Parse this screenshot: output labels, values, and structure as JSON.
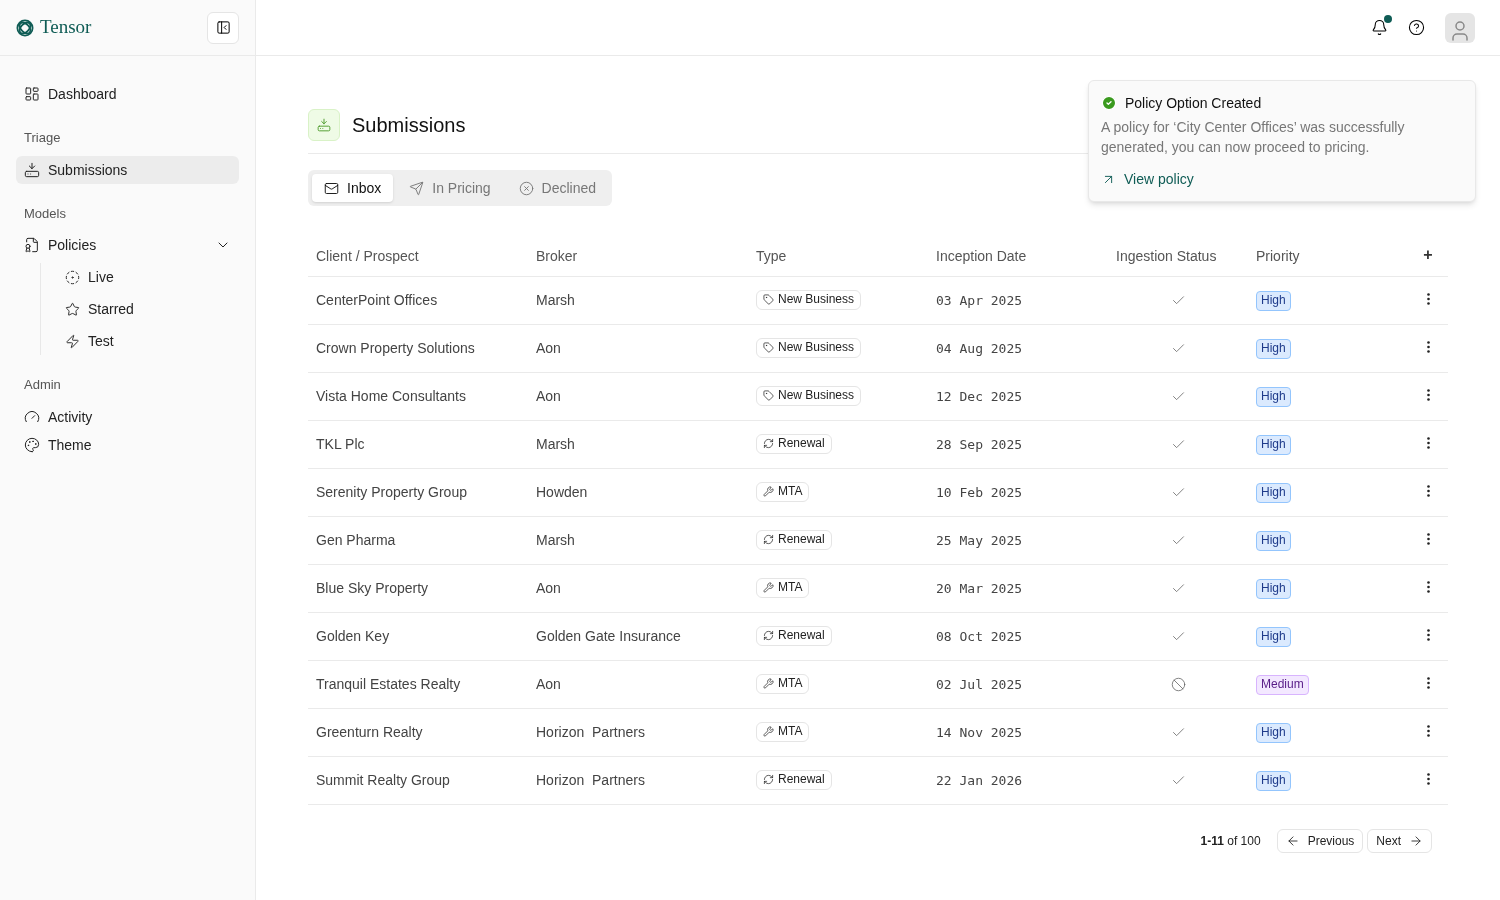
{
  "brand": {
    "name": "Tensor"
  },
  "sidebar": {
    "items": [
      {
        "kind": "item",
        "label": "Dashboard",
        "selected": false
      },
      {
        "kind": "heading",
        "label": "Triage"
      },
      {
        "kind": "item",
        "label": "Submissions",
        "selected": true
      },
      {
        "kind": "heading",
        "label": "Models"
      },
      {
        "kind": "item",
        "label": "Policies",
        "selected": false,
        "expanded": true,
        "children": [
          {
            "label": "Live",
            "selected": false
          },
          {
            "label": "Starred",
            "selected": false
          },
          {
            "label": "Test",
            "selected": false
          }
        ]
      },
      {
        "kind": "heading",
        "label": "Admin"
      },
      {
        "kind": "item",
        "label": "Activity",
        "selected": false
      },
      {
        "kind": "item",
        "label": "Theme",
        "selected": false
      }
    ]
  },
  "header": {
    "notifications_unread": true
  },
  "page": {
    "title": "Submissions"
  },
  "tabs": [
    {
      "label": "Inbox",
      "selected": true
    },
    {
      "label": "In Pricing",
      "selected": false
    },
    {
      "label": "Declined",
      "selected": false
    }
  ],
  "table": {
    "columns": [
      "Client / Prospect",
      "Broker",
      "Type",
      "Inception Date",
      "Ingestion Status",
      "Priority"
    ],
    "add_column": "+",
    "rows": [
      {
        "client": "CenterPoint Offices",
        "broker": "Marsh",
        "type": {
          "kind": "new_business",
          "label": "New Business"
        },
        "date": "03 Apr 2025",
        "ingested": true,
        "priority": {
          "kind": "high",
          "label": "High"
        }
      },
      {
        "client": "Crown Property Solutions",
        "broker": "Aon",
        "type": {
          "kind": "new_business",
          "label": "New Business"
        },
        "date": "04 Aug 2025",
        "ingested": true,
        "priority": {
          "kind": "high",
          "label": "High"
        }
      },
      {
        "client": "Vista Home Consultants",
        "broker": "Aon",
        "type": {
          "kind": "new_business",
          "label": "New Business"
        },
        "date": "12 Dec 2025",
        "ingested": true,
        "priority": {
          "kind": "high",
          "label": "High"
        }
      },
      {
        "client": "TKL Plc",
        "broker": "Marsh",
        "type": {
          "kind": "renewal",
          "label": "Renewal"
        },
        "date": "28 Sep 2025",
        "ingested": true,
        "priority": {
          "kind": "high",
          "label": "High"
        }
      },
      {
        "client": "Serenity Property Group",
        "broker": "Howden",
        "type": {
          "kind": "mta",
          "label": "MTA"
        },
        "date": "10 Feb 2025",
        "ingested": true,
        "priority": {
          "kind": "high",
          "label": "High"
        }
      },
      {
        "client": "Gen Pharma",
        "broker": "Marsh",
        "type": {
          "kind": "renewal",
          "label": "Renewal"
        },
        "date": "25 May 2025",
        "ingested": true,
        "priority": {
          "kind": "high",
          "label": "High"
        }
      },
      {
        "client": "Blue Sky Property",
        "broker": "Aon",
        "type": {
          "kind": "mta",
          "label": "MTA"
        },
        "date": "20 Mar 2025",
        "ingested": true,
        "priority": {
          "kind": "high",
          "label": "High"
        }
      },
      {
        "client": "Golden Key",
        "broker": "Golden Gate Insurance",
        "type": {
          "kind": "renewal",
          "label": "Renewal"
        },
        "date": "08 Oct 2025",
        "ingested": true,
        "priority": {
          "kind": "high",
          "label": "High"
        }
      },
      {
        "client": "Tranquil Estates Realty",
        "broker": "Aon",
        "type": {
          "kind": "mta",
          "label": "MTA"
        },
        "date": "02 Jul 2025",
        "ingested": false,
        "priority": {
          "kind": "medium",
          "label": "Medium"
        }
      },
      {
        "client": "Greenturn Realty",
        "broker": "Horizon  Partners",
        "type": {
          "kind": "mta",
          "label": "MTA"
        },
        "date": "14 Nov 2025",
        "ingested": true,
        "priority": {
          "kind": "high",
          "label": "High"
        }
      },
      {
        "client": "Summit Realty Group",
        "broker": "Horizon  Partners",
        "type": {
          "kind": "renewal",
          "label": "Renewal"
        },
        "date": "22 Jan 2026",
        "ingested": true,
        "priority": {
          "kind": "high",
          "label": "High"
        }
      }
    ]
  },
  "pagination": {
    "range": "**1-11** of 100",
    "previous": "Previous",
    "next": "Next"
  },
  "toast": {
    "title": "Policy Option Created",
    "message": "A policy for ‘City Center Offices’ was successfully generated, you can now proceed to pricing.",
    "action": "View policy"
  }
}
